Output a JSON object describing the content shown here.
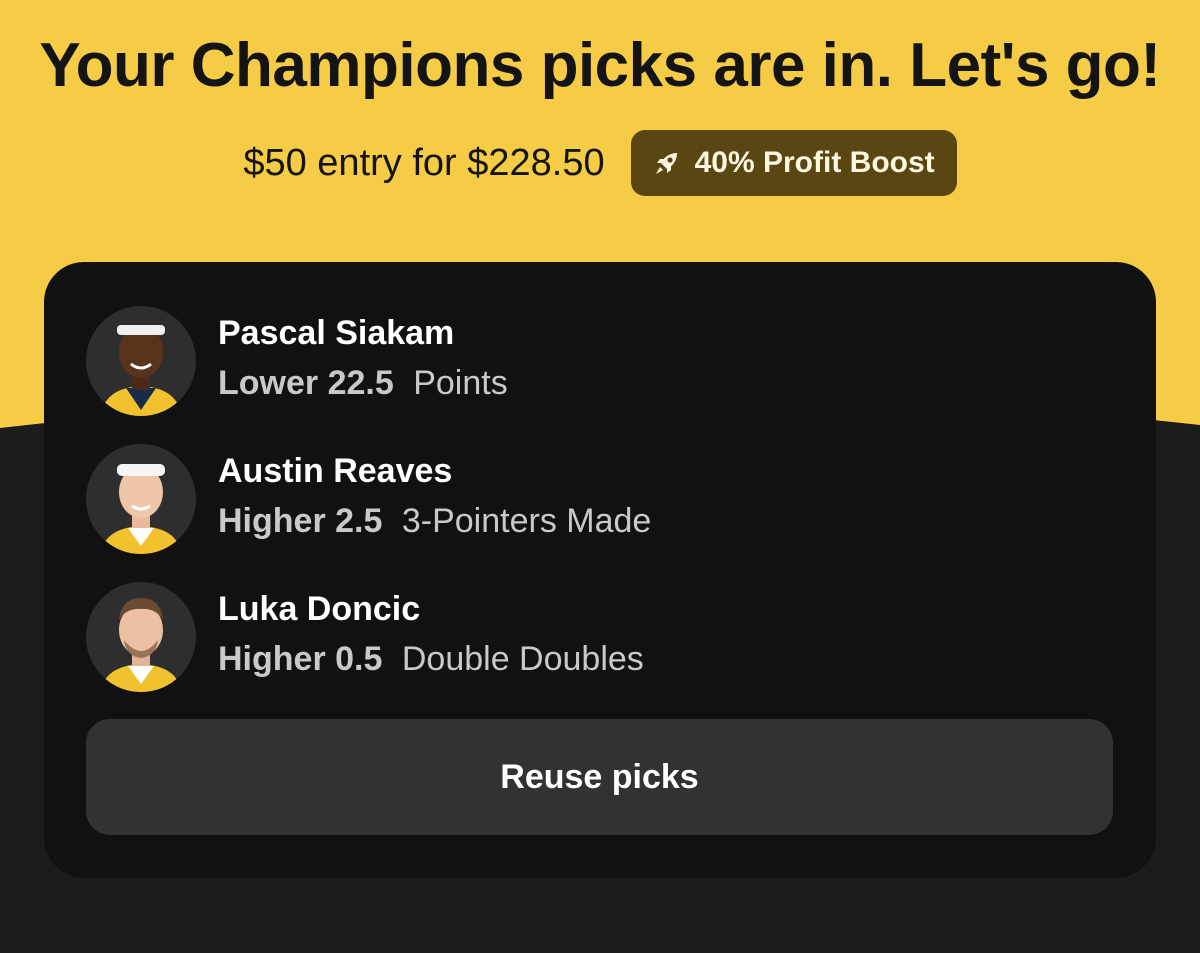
{
  "header": {
    "title": "Your Champions picks are in. Let's go!",
    "entry_text": "$50 entry for $228.50",
    "boost": {
      "icon": "rocket-icon",
      "label": "40% Profit Boost"
    }
  },
  "colors": {
    "accent_yellow": "#f6cc47",
    "card_bg": "#111111",
    "page_bg": "#1c1c1c",
    "boost_bg": "#5a4612",
    "button_bg": "#323232"
  },
  "picks": [
    {
      "player": "Pascal Siakam",
      "direction": "Lower",
      "line": "22.5",
      "stat": "Points"
    },
    {
      "player": "Austin Reaves",
      "direction": "Higher",
      "line": "2.5",
      "stat": "3-Pointers Made"
    },
    {
      "player": "Luka Doncic",
      "direction": "Higher",
      "line": "0.5",
      "stat": "Double Doubles"
    }
  ],
  "actions": {
    "reuse_label": "Reuse picks"
  }
}
